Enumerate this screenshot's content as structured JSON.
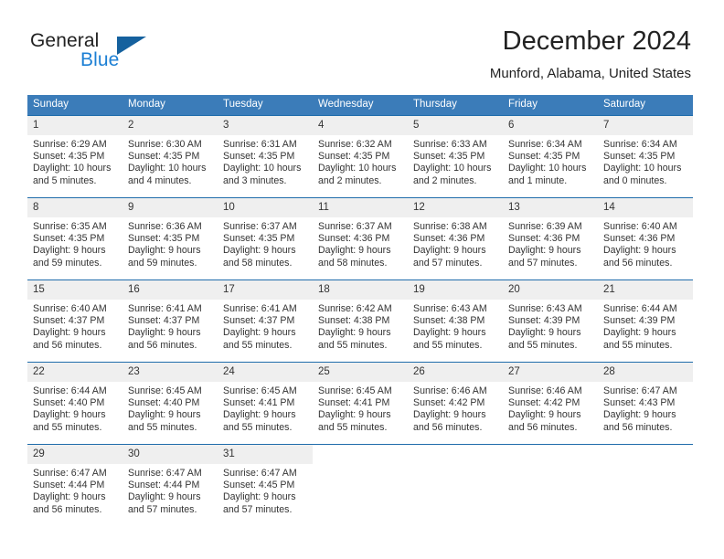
{
  "logo": {
    "word1": "General",
    "word2": "Blue",
    "triangle_color": "#15619e",
    "blue_color": "#1c7fd4"
  },
  "header": {
    "title": "December 2024",
    "subtitle": "Munford, Alabama, United States"
  },
  "theme": {
    "header_blue": "#3b7cb9",
    "row_border_blue": "#1f6cab",
    "daynum_band": "#efefef"
  },
  "weekday_headers": [
    "Sunday",
    "Monday",
    "Tuesday",
    "Wednesday",
    "Thursday",
    "Friday",
    "Saturday"
  ],
  "labels": {
    "sunrise": "Sunrise:",
    "sunset": "Sunset:",
    "daylight": "Daylight:"
  },
  "weeks": [
    [
      {
        "day": "1",
        "l1": "Sunrise: 6:29 AM",
        "l2": "Sunset: 4:35 PM",
        "l3": "Daylight: 10 hours",
        "l4": "and 5 minutes."
      },
      {
        "day": "2",
        "l1": "Sunrise: 6:30 AM",
        "l2": "Sunset: 4:35 PM",
        "l3": "Daylight: 10 hours",
        "l4": "and 4 minutes."
      },
      {
        "day": "3",
        "l1": "Sunrise: 6:31 AM",
        "l2": "Sunset: 4:35 PM",
        "l3": "Daylight: 10 hours",
        "l4": "and 3 minutes."
      },
      {
        "day": "4",
        "l1": "Sunrise: 6:32 AM",
        "l2": "Sunset: 4:35 PM",
        "l3": "Daylight: 10 hours",
        "l4": "and 2 minutes."
      },
      {
        "day": "5",
        "l1": "Sunrise: 6:33 AM",
        "l2": "Sunset: 4:35 PM",
        "l3": "Daylight: 10 hours",
        "l4": "and 2 minutes."
      },
      {
        "day": "6",
        "l1": "Sunrise: 6:34 AM",
        "l2": "Sunset: 4:35 PM",
        "l3": "Daylight: 10 hours",
        "l4": "and 1 minute."
      },
      {
        "day": "7",
        "l1": "Sunrise: 6:34 AM",
        "l2": "Sunset: 4:35 PM",
        "l3": "Daylight: 10 hours",
        "l4": "and 0 minutes."
      }
    ],
    [
      {
        "day": "8",
        "l1": "Sunrise: 6:35 AM",
        "l2": "Sunset: 4:35 PM",
        "l3": "Daylight: 9 hours",
        "l4": "and 59 minutes."
      },
      {
        "day": "9",
        "l1": "Sunrise: 6:36 AM",
        "l2": "Sunset: 4:35 PM",
        "l3": "Daylight: 9 hours",
        "l4": "and 59 minutes."
      },
      {
        "day": "10",
        "l1": "Sunrise: 6:37 AM",
        "l2": "Sunset: 4:35 PM",
        "l3": "Daylight: 9 hours",
        "l4": "and 58 minutes."
      },
      {
        "day": "11",
        "l1": "Sunrise: 6:37 AM",
        "l2": "Sunset: 4:36 PM",
        "l3": "Daylight: 9 hours",
        "l4": "and 58 minutes."
      },
      {
        "day": "12",
        "l1": "Sunrise: 6:38 AM",
        "l2": "Sunset: 4:36 PM",
        "l3": "Daylight: 9 hours",
        "l4": "and 57 minutes."
      },
      {
        "day": "13",
        "l1": "Sunrise: 6:39 AM",
        "l2": "Sunset: 4:36 PM",
        "l3": "Daylight: 9 hours",
        "l4": "and 57 minutes."
      },
      {
        "day": "14",
        "l1": "Sunrise: 6:40 AM",
        "l2": "Sunset: 4:36 PM",
        "l3": "Daylight: 9 hours",
        "l4": "and 56 minutes."
      }
    ],
    [
      {
        "day": "15",
        "l1": "Sunrise: 6:40 AM",
        "l2": "Sunset: 4:37 PM",
        "l3": "Daylight: 9 hours",
        "l4": "and 56 minutes."
      },
      {
        "day": "16",
        "l1": "Sunrise: 6:41 AM",
        "l2": "Sunset: 4:37 PM",
        "l3": "Daylight: 9 hours",
        "l4": "and 56 minutes."
      },
      {
        "day": "17",
        "l1": "Sunrise: 6:41 AM",
        "l2": "Sunset: 4:37 PM",
        "l3": "Daylight: 9 hours",
        "l4": "and 55 minutes."
      },
      {
        "day": "18",
        "l1": "Sunrise: 6:42 AM",
        "l2": "Sunset: 4:38 PM",
        "l3": "Daylight: 9 hours",
        "l4": "and 55 minutes."
      },
      {
        "day": "19",
        "l1": "Sunrise: 6:43 AM",
        "l2": "Sunset: 4:38 PM",
        "l3": "Daylight: 9 hours",
        "l4": "and 55 minutes."
      },
      {
        "day": "20",
        "l1": "Sunrise: 6:43 AM",
        "l2": "Sunset: 4:39 PM",
        "l3": "Daylight: 9 hours",
        "l4": "and 55 minutes."
      },
      {
        "day": "21",
        "l1": "Sunrise: 6:44 AM",
        "l2": "Sunset: 4:39 PM",
        "l3": "Daylight: 9 hours",
        "l4": "and 55 minutes."
      }
    ],
    [
      {
        "day": "22",
        "l1": "Sunrise: 6:44 AM",
        "l2": "Sunset: 4:40 PM",
        "l3": "Daylight: 9 hours",
        "l4": "and 55 minutes."
      },
      {
        "day": "23",
        "l1": "Sunrise: 6:45 AM",
        "l2": "Sunset: 4:40 PM",
        "l3": "Daylight: 9 hours",
        "l4": "and 55 minutes."
      },
      {
        "day": "24",
        "l1": "Sunrise: 6:45 AM",
        "l2": "Sunset: 4:41 PM",
        "l3": "Daylight: 9 hours",
        "l4": "and 55 minutes."
      },
      {
        "day": "25",
        "l1": "Sunrise: 6:45 AM",
        "l2": "Sunset: 4:41 PM",
        "l3": "Daylight: 9 hours",
        "l4": "and 55 minutes."
      },
      {
        "day": "26",
        "l1": "Sunrise: 6:46 AM",
        "l2": "Sunset: 4:42 PM",
        "l3": "Daylight: 9 hours",
        "l4": "and 56 minutes."
      },
      {
        "day": "27",
        "l1": "Sunrise: 6:46 AM",
        "l2": "Sunset: 4:42 PM",
        "l3": "Daylight: 9 hours",
        "l4": "and 56 minutes."
      },
      {
        "day": "28",
        "l1": "Sunrise: 6:47 AM",
        "l2": "Sunset: 4:43 PM",
        "l3": "Daylight: 9 hours",
        "l4": "and 56 minutes."
      }
    ],
    [
      {
        "day": "29",
        "l1": "Sunrise: 6:47 AM",
        "l2": "Sunset: 4:44 PM",
        "l3": "Daylight: 9 hours",
        "l4": "and 56 minutes."
      },
      {
        "day": "30",
        "l1": "Sunrise: 6:47 AM",
        "l2": "Sunset: 4:44 PM",
        "l3": "Daylight: 9 hours",
        "l4": "and 57 minutes."
      },
      {
        "day": "31",
        "l1": "Sunrise: 6:47 AM",
        "l2": "Sunset: 4:45 PM",
        "l3": "Daylight: 9 hours",
        "l4": "and 57 minutes."
      },
      {
        "day": "",
        "l1": "",
        "l2": "",
        "l3": "",
        "l4": ""
      },
      {
        "day": "",
        "l1": "",
        "l2": "",
        "l3": "",
        "l4": ""
      },
      {
        "day": "",
        "l1": "",
        "l2": "",
        "l3": "",
        "l4": ""
      },
      {
        "day": "",
        "l1": "",
        "l2": "",
        "l3": "",
        "l4": ""
      }
    ]
  ]
}
